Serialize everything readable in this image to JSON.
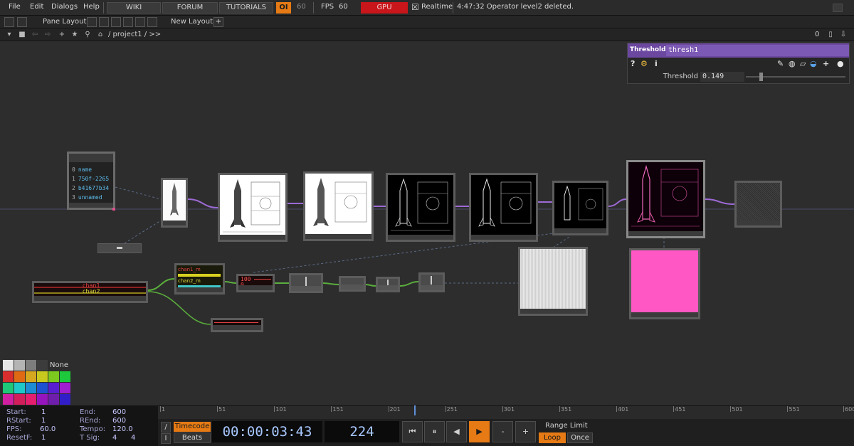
{
  "menu": {
    "file": "File",
    "edit": "Edit",
    "dialogs": "Dialogs",
    "help": "Help"
  },
  "toolbar": {
    "wiki": "WIKI",
    "forum": "FORUM",
    "tutorials": "TUTORIALS",
    "oi_badge": "OI",
    "oi_count": "60",
    "fps_label": "FPS",
    "fps_value": "60",
    "gpu": "GPU",
    "realtime": "Realtime",
    "realtime_checked": "☒",
    "status": "4:47:32 Operator level2 deleted.",
    "gpu_color": "#c8161b",
    "oi_color": "#e67a14"
  },
  "panebar": {
    "pane_layout": "Pane Layout",
    "new_layout": "New Layout",
    "add": "+"
  },
  "pathbar": {
    "path": "/ project1 / >>",
    "counter": "0"
  },
  "param_panel": {
    "type": "Threshold",
    "name": "thresh1",
    "param_label": "Threshold",
    "param_value": "0.149",
    "header_color": "#6b47a0",
    "value_fraction": 0.149
  },
  "table_dat": {
    "rows": [
      {
        "idx": "0",
        "val": "name"
      },
      {
        "idx": "1",
        "val": "750f-2265"
      },
      {
        "idx": "2",
        "val": "b41677b34"
      },
      {
        "idx": "3",
        "val": "unnamed"
      }
    ]
  },
  "chop_nodes": {
    "trail_labels": [
      "chan1",
      "chan2"
    ],
    "math_value": "100",
    "math_value2": "0",
    "select_labels": [
      "chan1_m",
      "chan2_m"
    ]
  },
  "palette": {
    "none_label": "None",
    "swatches": [
      "#e6e6e6",
      "#b4b4b4",
      "#7d7d7d",
      "#3c3c3c",
      "#d92e2e",
      "#e06a14",
      "#d6a81f",
      "#c8c81e",
      "#7cc81e",
      "#1ec83c",
      "#1ec878",
      "#1ec8c8",
      "#1e8cd2",
      "#1e50d2",
      "#5a1ed2",
      "#a01ed2",
      "#d21ea0",
      "#d21e5a",
      "#e61e6e",
      "#9614be",
      "#6e1eaa",
      "#321ec8"
    ]
  },
  "stats": {
    "start_label": "Start:",
    "start": "1",
    "rstart_label": "RStart:",
    "rstart": "1",
    "fps_label": "FPS:",
    "fps": "60.0",
    "resetf_label": "ResetF:",
    "resetf": "1",
    "end_label": "End:",
    "end": "600",
    "rend_label": "REnd:",
    "rend": "600",
    "tempo_label": "Tempo:",
    "tempo": "120.0",
    "tsig_label": "T Sig:",
    "tsig_a": "4",
    "tsig_b": "4"
  },
  "timeline": {
    "ticks": [
      "1",
      "51",
      "101",
      "151",
      "201",
      "251",
      "301",
      "351",
      "401",
      "451",
      "501",
      "551",
      "600"
    ],
    "timecode_label": "Timecode",
    "beats_label": "Beats",
    "timecode": "00:00:03:43",
    "frame": "224",
    "range_limit": "Range Limit",
    "loop": "Loop",
    "once": "Once",
    "slash_top": "/",
    "slash_bottom": "I",
    "current_frame_value": 224
  },
  "transport": {
    "rewind": "⏮",
    "pause": "⏸",
    "step_back": "◀",
    "play": "▶",
    "minus": "-",
    "plus": "+"
  }
}
